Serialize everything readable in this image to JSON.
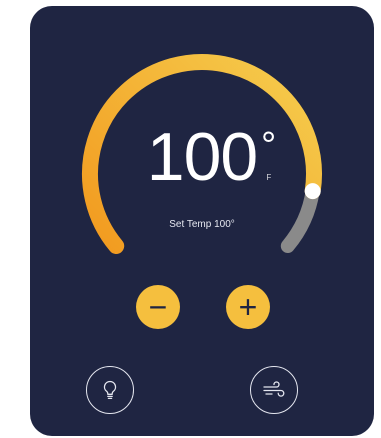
{
  "thermostat": {
    "temperature": "100",
    "degree_symbol": "°",
    "unit": "F",
    "set_temp_label": "Set Temp 100°",
    "dial_level": 0.88
  },
  "controls": {
    "decrease_label": "−",
    "increase_label": "+"
  },
  "icons": {
    "decrease": "minus-icon",
    "increase": "plus-icon",
    "light": "lightbulb-icon",
    "fan": "wind-icon"
  },
  "colors": {
    "card_background": "#1f2542",
    "arc_gradient_start": "#f29a1f",
    "arc_gradient_end": "#f5c94a",
    "arc_track": "#8a8a8a",
    "button_fill": "#f5bf3e",
    "knob": "#ffffff"
  }
}
